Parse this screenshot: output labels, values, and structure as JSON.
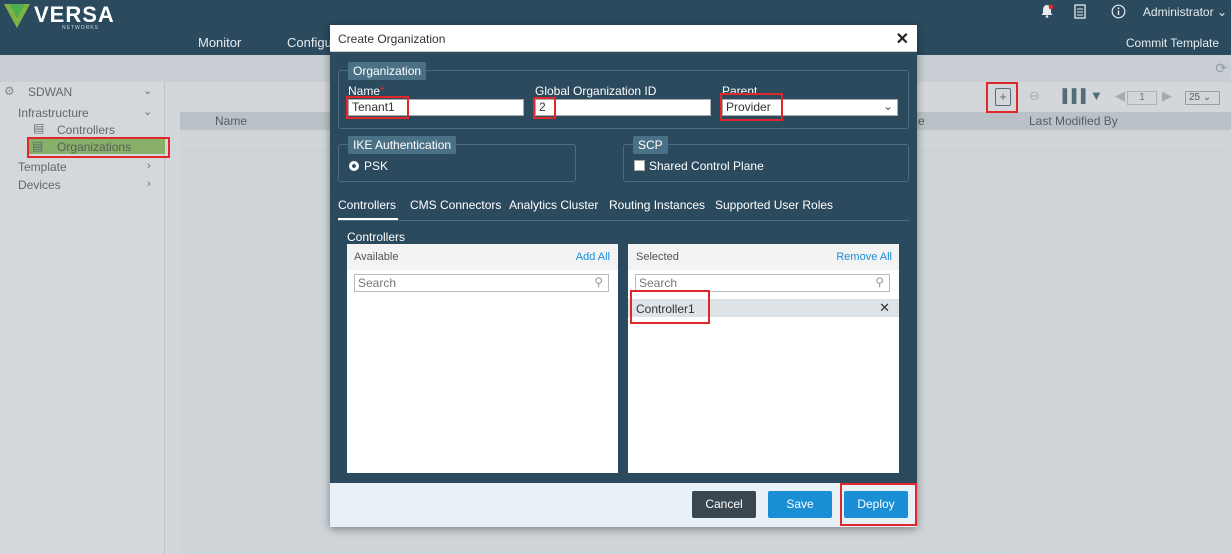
{
  "topbar": {
    "brand": "VERSA",
    "brand_sub": "NETWORKS",
    "nav": [
      "Monitor",
      "Configu"
    ],
    "admin": "Administrator",
    "commit": "Commit Template"
  },
  "sidebar": {
    "root": "SDWAN",
    "infrastructure": "Infrastructure",
    "controllers": "Controllers",
    "organizations": "Organizations",
    "template": "Template",
    "devices": "Devices"
  },
  "table": {
    "col_name": "Name",
    "col_partial": "e",
    "col_last": "Last Modified By",
    "page": "1",
    "page_size": "25"
  },
  "modal": {
    "title": "Create Organization",
    "org_legend": "Organization",
    "name_label": "Name",
    "required_mark": "*",
    "name_value": "Tenant1",
    "gid_label": "Global Organization ID",
    "gid_value": "2",
    "parent_label": "Parent",
    "parent_value": "Provider",
    "ike_legend": "IKE Authentication",
    "psk_label": "PSK",
    "scp_legend": "SCP",
    "scp_label": "Shared Control Plane",
    "tabs": [
      "Controllers",
      "CMS Connectors",
      "Analytics Cluster",
      "Routing Instances",
      "Supported User Roles"
    ],
    "controllers_label": "Controllers",
    "available": "Available",
    "add_all": "Add All",
    "selected": "Selected",
    "remove_all": "Remove All",
    "search_placeholder": "Search",
    "selected_items": [
      "Controller1"
    ],
    "cancel": "Cancel",
    "save": "Save",
    "deploy": "Deploy"
  },
  "colors": {
    "header": "#2b4a5e",
    "accent": "#1a8fd6",
    "highlight": "#e0282b",
    "active_item": "#7cb342"
  }
}
